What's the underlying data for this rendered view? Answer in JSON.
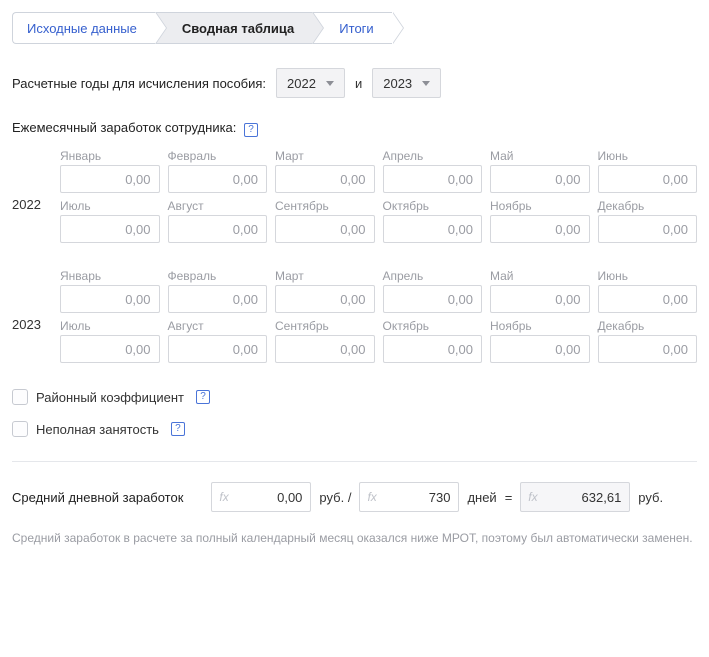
{
  "breadcrumbs": [
    {
      "label": "Исходные данные",
      "active": false
    },
    {
      "label": "Сводная таблица",
      "active": true
    },
    {
      "label": "Итоги",
      "active": false
    }
  ],
  "years_row": {
    "label": "Расчетные годы для исчисления пособия:",
    "conj": "и",
    "year_a": "2022",
    "year_b": "2023"
  },
  "earnings": {
    "heading": "Ежемесячный заработок сотрудника:",
    "default_value": "0,00",
    "year_labels": [
      "2022",
      "2023"
    ],
    "months": [
      "Январь",
      "Февраль",
      "Март",
      "Апрель",
      "Май",
      "Июнь",
      "Июль",
      "Август",
      "Сентябрь",
      "Октябрь",
      "Ноябрь",
      "Декабрь"
    ]
  },
  "checkboxes": {
    "regional": "Районный коэффициент",
    "parttime": "Неполная занятость"
  },
  "avg": {
    "label": "Средний дневной заработок",
    "total": "0,00",
    "unit_money_slash": "руб. /",
    "days": "730",
    "unit_days": "дней",
    "eq": "=",
    "result": "632,61",
    "unit_money": "руб."
  },
  "note": "Средний заработок в расчете за полный календарный месяц оказался ниже МРОТ, поэтому был автоматически заменен."
}
